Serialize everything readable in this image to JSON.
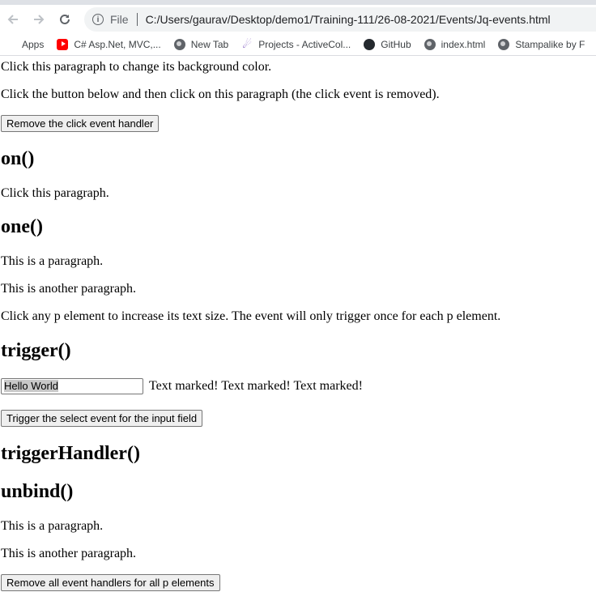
{
  "browser": {
    "scheme_label": "File",
    "url": "C:/Users/gaurav/Desktop/demo1/Training-111/26-08-2021/Events/Jq-events.html",
    "bookmarks": [
      {
        "label": "Apps",
        "icon": "apps-grid-icon"
      },
      {
        "label": "C# Asp.Net, MVC,...",
        "icon": "youtube-icon"
      },
      {
        "label": "New Tab",
        "icon": "globe-icon"
      },
      {
        "label": "Projects - ActiveCol...",
        "icon": "activecollab-icon"
      },
      {
        "label": "GitHub",
        "icon": "github-icon"
      },
      {
        "label": "index.html",
        "icon": "globe-icon"
      },
      {
        "label": "Stampalike by F",
        "icon": "globe-icon"
      }
    ]
  },
  "page": {
    "p_change_bg": "Click this paragraph to change its background color.",
    "p_remove_info": "Click the button below and then click on this paragraph (the click event is removed).",
    "btn_remove_click": "Remove the click event handler",
    "h_on": "on()",
    "p_click_this": "Click this paragraph.",
    "h_one": "one()",
    "p_one_1": "This is a paragraph.",
    "p_one_2": "This is another paragraph.",
    "p_one_3": "Click any p element to increase its text size. The event will only trigger once for each p element.",
    "h_trigger": "trigger()",
    "input_value": "Hello World",
    "marked_text": "Text marked! Text marked! Text marked!",
    "btn_trigger_select": "Trigger the select event for the input field",
    "h_trigger_handler": "triggerHandler()",
    "h_unbind": "unbind()",
    "p_unbind_1": "This is a paragraph.",
    "p_unbind_2": "This is another paragraph.",
    "btn_remove_all": "Remove all event handlers for all p elements"
  }
}
